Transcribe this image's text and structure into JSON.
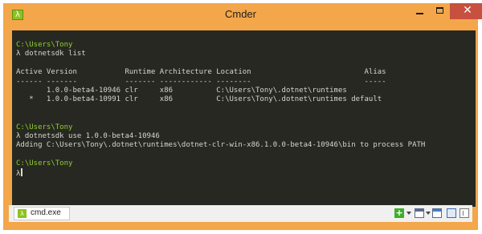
{
  "window": {
    "title": "Cmder",
    "icon": "lambda-icon",
    "accent_color": "#f3a64a",
    "close_color": "#c7503f"
  },
  "console": {
    "background": "#272822",
    "path_color": "#8ed12a",
    "lines": [
      {
        "kind": "path",
        "text": "C:\\Users\\Tony"
      },
      {
        "kind": "prompt",
        "text": "λ dotnetsdk list"
      },
      {
        "kind": "blank",
        "text": ""
      },
      {
        "kind": "output",
        "text": "Active Version           Runtime Architecture Location                          Alias"
      },
      {
        "kind": "output",
        "text": "------ -------           ------- ------------ --------                          -----"
      },
      {
        "kind": "output",
        "text": "       1.0.0-beta4-10946 clr     x86          C:\\Users\\Tony\\.dotnet\\runtimes"
      },
      {
        "kind": "output",
        "text": "   *   1.0.0-beta4-10991 clr     x86          C:\\Users\\Tony\\.dotnet\\runtimes default"
      },
      {
        "kind": "blank",
        "text": ""
      },
      {
        "kind": "blank",
        "text": ""
      },
      {
        "kind": "path",
        "text": "C:\\Users\\Tony"
      },
      {
        "kind": "prompt",
        "text": "λ dotnetsdk use 1.0.0-beta4-10946"
      },
      {
        "kind": "output",
        "text": "Adding C:\\Users\\Tony\\.dotnet\\runtimes\\dotnet-clr-win-x86.1.0.0-beta4-10946\\bin to process PATH"
      },
      {
        "kind": "blank",
        "text": ""
      },
      {
        "kind": "path",
        "text": "C:\\Users\\Tony"
      },
      {
        "kind": "cursor",
        "text": "λ"
      }
    ]
  },
  "tabbar": {
    "tab_label": "cmd.exe",
    "tools": [
      "add-tab-icon",
      "console-window-icon",
      "new-window-icon",
      "split-pane-icon",
      "panel-layout-icon"
    ]
  }
}
